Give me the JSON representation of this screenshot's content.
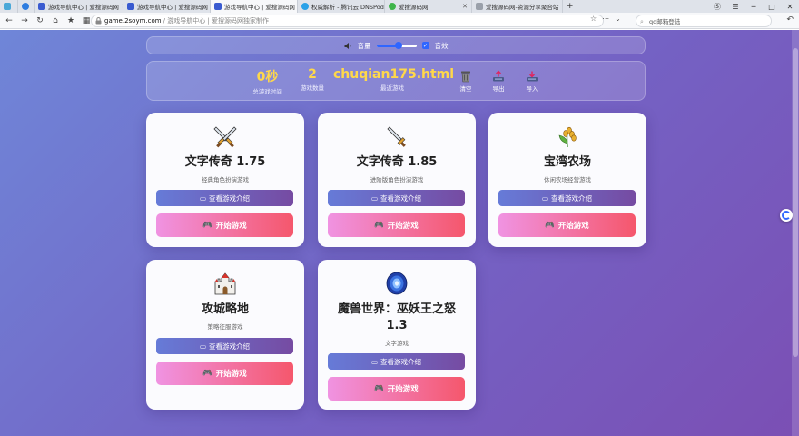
{
  "browser": {
    "tabs": [
      {
        "label": "",
        "color": "#4aa8d8"
      },
      {
        "label": "",
        "color": "#2e7de0"
      },
      {
        "label": "游戏导航中心 | 爱搜源码网",
        "color": "#3a5bd0"
      },
      {
        "label": "游戏导航中心 | 爱搜源码网",
        "color": "#3a5bd0"
      },
      {
        "label": "游戏导航中心 | 爱搜源码网",
        "color": "#3a5bd0"
      },
      {
        "label": "权威解析 - 腾讯云 DNSPod",
        "color": "#2aa2e8"
      },
      {
        "label": "爱搜源码网",
        "color": "#3fb54a"
      },
      {
        "label": "爱搜源码网-资源分享聚合站",
        "color": "#9aa0aa"
      }
    ],
    "url_host": "game.2soym.com",
    "url_path": "/ 游戏导航中心 | 爱搜源码网独家制作",
    "search_placeholder": "qq邮箱登陆"
  },
  "controls": {
    "volume_label": "音量",
    "volume_level": 0.55,
    "sfx_label": "音效",
    "sfx_checked": true
  },
  "stats": {
    "total_time_value": "0秒",
    "total_time_label": "总游戏时间",
    "count_value": "2",
    "count_label": "游戏数量",
    "recent_value": "chuqian175.html",
    "recent_label": "最近游戏",
    "clear_label": "清空",
    "export_label": "导出",
    "import_label": "导入"
  },
  "buttons": {
    "intro_label": "查看游戏介绍",
    "play_label": "开始游戏"
  },
  "games": [
    {
      "title": "文字传奇 1.75",
      "subtitle": "经典角色扮演游戏",
      "icon": "crossed-swords-icon"
    },
    {
      "title": "文字传奇 1.85",
      "subtitle": "进阶版角色扮演游戏",
      "icon": "sword-icon"
    },
    {
      "title": "宝湾农场",
      "subtitle": "休闲农场经营游戏",
      "icon": "wheat-icon"
    },
    {
      "title": "攻城略地",
      "subtitle": "策略征服游戏",
      "icon": "castle-icon"
    },
    {
      "title": "魔兽世界：巫妖王之怒 1.3",
      "subtitle": "文字游戏",
      "icon": "portal-icon"
    }
  ],
  "colors": {
    "accent": "#2f66ff",
    "stat_number": "#ffd84a",
    "intro_gradient": [
      "#667bd8",
      "#764ba2"
    ],
    "play_gradient": [
      "#f093e2",
      "#f5576c"
    ]
  }
}
